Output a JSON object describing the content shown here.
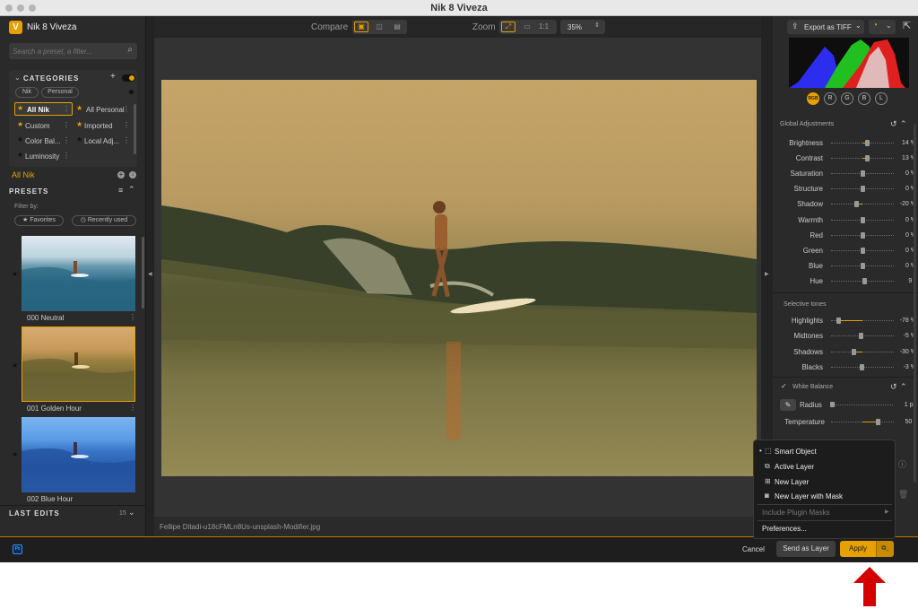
{
  "window": {
    "title": "Nik 8 Viveza"
  },
  "app": {
    "name": "Nik 8 Viveza"
  },
  "search": {
    "placeholder": "Search a preset, a filter..."
  },
  "categories": {
    "header": "CATEGORIES",
    "filters": [
      "Nik",
      "Personal"
    ],
    "items": [
      {
        "label": "All Nik",
        "starred": true
      },
      {
        "label": "All Personal",
        "starred": true
      },
      {
        "label": "Custom",
        "starred": true
      },
      {
        "label": "Imported",
        "starred": true
      },
      {
        "label": "Color Bal...",
        "starred": false
      },
      {
        "label": "Local Adj...",
        "starred": false
      },
      {
        "label": "Luminosity",
        "starred": false
      }
    ]
  },
  "current_category": "All Nik",
  "presets": {
    "header": "PRESETS",
    "filter_label": "Filter by:",
    "filter_favorites": "★ Favorites",
    "filter_recent": "◷ Recently used",
    "items": [
      {
        "name": "000 Neutral"
      },
      {
        "name": "001 Golden Hour"
      },
      {
        "name": "002 Blue Hour"
      }
    ]
  },
  "last_edits": {
    "label": "LAST EDITS",
    "count": "15"
  },
  "toolbar": {
    "compare_label": "Compare",
    "zoom_label": "Zoom",
    "zoom_value": "35%",
    "one_to_one": "1:1"
  },
  "image": {
    "filename": "Fellipe Ditadi-u18cFMLn8Us-unsplash-Modifier.jpg"
  },
  "export": {
    "label": "Export as TIFF"
  },
  "histogram": {
    "channels": [
      "RGB",
      "R",
      "G",
      "B",
      "L"
    ]
  },
  "global": {
    "title": "Global Adjustments",
    "sliders": [
      {
        "label": "Brightness",
        "value": "14 %",
        "frac": 0.57
      },
      {
        "label": "Contrast",
        "value": "13 %",
        "frac": 0.565
      },
      {
        "label": "Saturation",
        "value": "0 %",
        "frac": 0.5
      },
      {
        "label": "Structure",
        "value": "0 %",
        "frac": 0.5
      },
      {
        "label": "Shadow",
        "value": "-20 %",
        "frac": 0.4
      },
      {
        "label": "Warmth",
        "value": "0 %",
        "frac": 0.5
      },
      {
        "label": "Red",
        "value": "0 %",
        "frac": 0.5
      },
      {
        "label": "Green",
        "value": "0 %",
        "frac": 0.5
      },
      {
        "label": "Blue",
        "value": "0 %",
        "frac": 0.5
      },
      {
        "label": "Hue",
        "value": "9 °",
        "frac": 0.53
      }
    ]
  },
  "selective": {
    "title": "Selective tones",
    "sliders": [
      {
        "label": "Highlights",
        "value": "-78 %",
        "frac": 0.11
      },
      {
        "label": "Midtones",
        "value": "-5 %",
        "frac": 0.475
      },
      {
        "label": "Shadows",
        "value": "-30 %",
        "frac": 0.35
      },
      {
        "label": "Blacks",
        "value": "-3 %",
        "frac": 0.485
      }
    ]
  },
  "white_balance": {
    "title": "White Balance",
    "radius_label": "Radius",
    "radius_value": "1 px",
    "temperature_label": "Temperature",
    "temperature_value": "50 °"
  },
  "dropdown": {
    "items": [
      "Smart Object",
      "Active Layer",
      "New Layer",
      "New Layer with Mask"
    ],
    "selected": "Smart Object",
    "include_masks": "Include Plugin Masks",
    "preferences": "Preferences..."
  },
  "bottom": {
    "cancel": "Cancel",
    "send_layer": "Send as Layer",
    "apply": "Apply",
    "ps_badge": "Ps"
  },
  "colors": {
    "accent": "#e6a000",
    "arrow": "#d40000"
  }
}
